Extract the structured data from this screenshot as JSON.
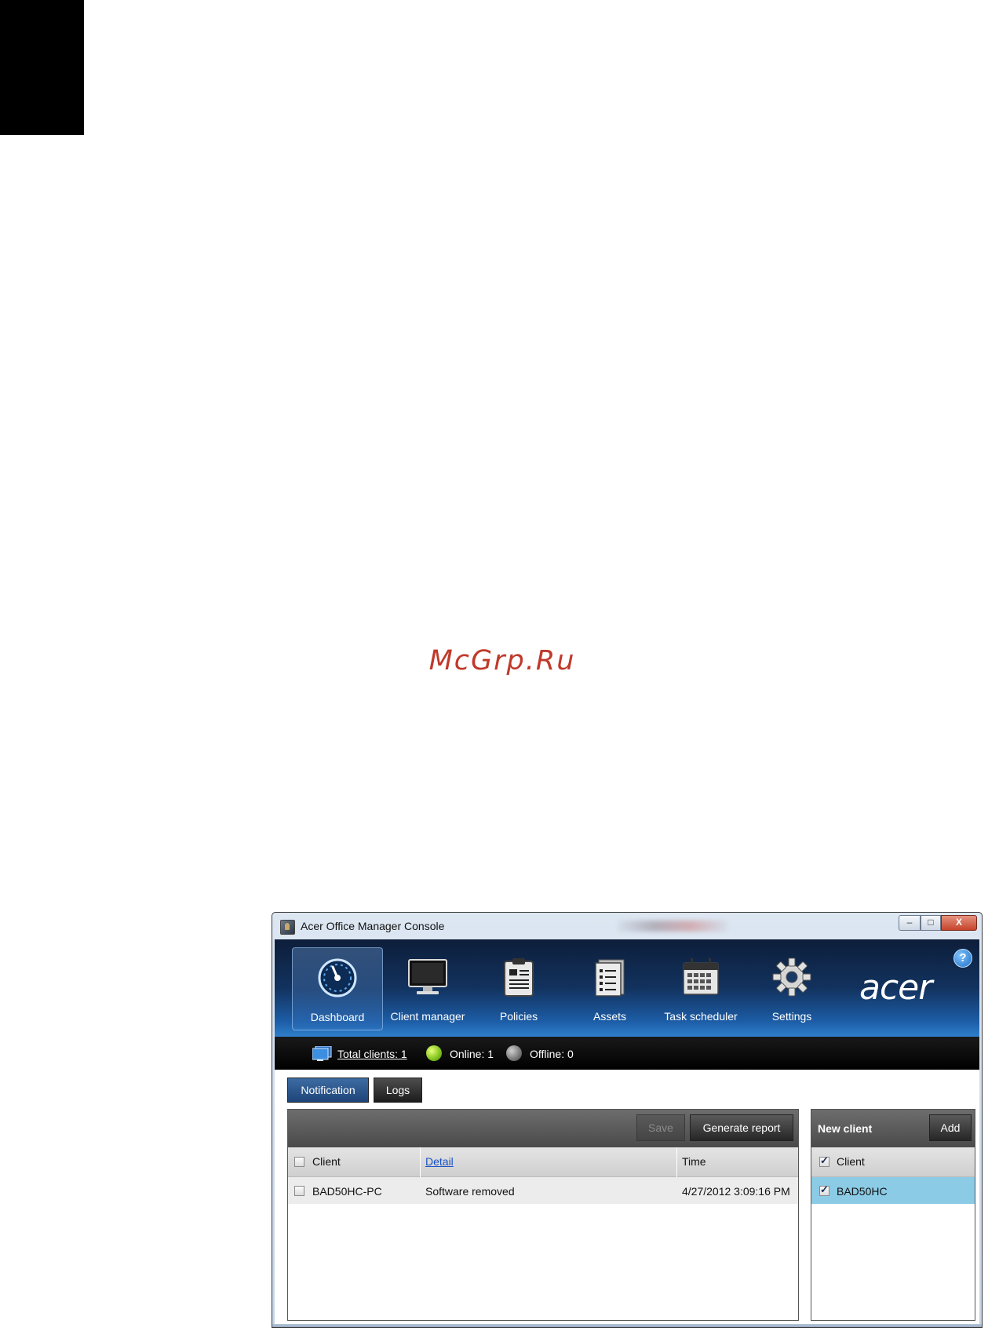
{
  "watermark": "McGrp.Ru",
  "window": {
    "title": "Acer Office Manager Console",
    "minimize": "–",
    "maximize": "□",
    "close": "X"
  },
  "nav": [
    {
      "label": "Dashboard",
      "icon": "dashboard-gauge-icon",
      "active": true
    },
    {
      "label": "Client manager",
      "icon": "monitor-icon",
      "active": false
    },
    {
      "label": "Policies",
      "icon": "clipboard-icon",
      "active": false
    },
    {
      "label": "Assets",
      "icon": "list-document-icon",
      "active": false
    },
    {
      "label": "Task scheduler",
      "icon": "calendar-icon",
      "active": false
    },
    {
      "label": "Settings",
      "icon": "gear-icon",
      "active": false
    }
  ],
  "brand": {
    "logo": "acer",
    "help": "?"
  },
  "status": {
    "total_clients": "Total clients: 1",
    "online": "Online: 1",
    "offline": "Offline: 0"
  },
  "tabs": {
    "notification": "Notification",
    "logs": "Logs"
  },
  "notifications": {
    "save_label": "Save",
    "generate_report_label": "Generate report",
    "columns": {
      "client": "Client",
      "detail": "Detail",
      "time": "Time"
    },
    "rows": [
      {
        "client": "BAD50HC-PC",
        "detail": "Software removed",
        "time": "4/27/2012 3:09:16 PM",
        "checked": false
      }
    ]
  },
  "new_client": {
    "title": "New client",
    "add_label": "Add",
    "column": "Client",
    "rows": [
      {
        "client": "BAD50HC",
        "checked": true
      }
    ]
  },
  "colors": {
    "toolbar_top": "#0d1e3a",
    "toolbar_bottom": "#2f7fcc",
    "online_dot": "#7fc21b",
    "offline_dot": "#777777",
    "selected_row": "#8bcbe6",
    "link": "#1a52c4"
  }
}
